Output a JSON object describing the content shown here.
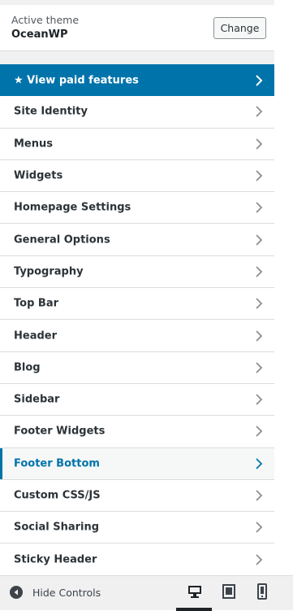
{
  "theme": {
    "label": "Active theme",
    "name": "OceanWP",
    "change_button": "Change"
  },
  "menu": {
    "paid": "★ View paid features",
    "items": [
      "Site Identity",
      "Menus",
      "Widgets",
      "Homepage Settings",
      "General Options",
      "Typography",
      "Top Bar",
      "Header",
      "Blog",
      "Sidebar",
      "Footer Widgets",
      "Footer Bottom",
      "Custom CSS/JS",
      "Social Sharing",
      "Sticky Header"
    ],
    "active_item": "Footer Bottom"
  },
  "footer": {
    "hide_controls": "Hide Controls",
    "icons": [
      "arrow-left-circle-icon",
      "desktop-icon",
      "tablet-icon",
      "mobile-icon"
    ],
    "selected_device": "desktop"
  },
  "colors": {
    "accent": "#0073aa",
    "panel_bg": "#f1f1f1",
    "border": "#dcdcde",
    "text": "#2c3338"
  }
}
